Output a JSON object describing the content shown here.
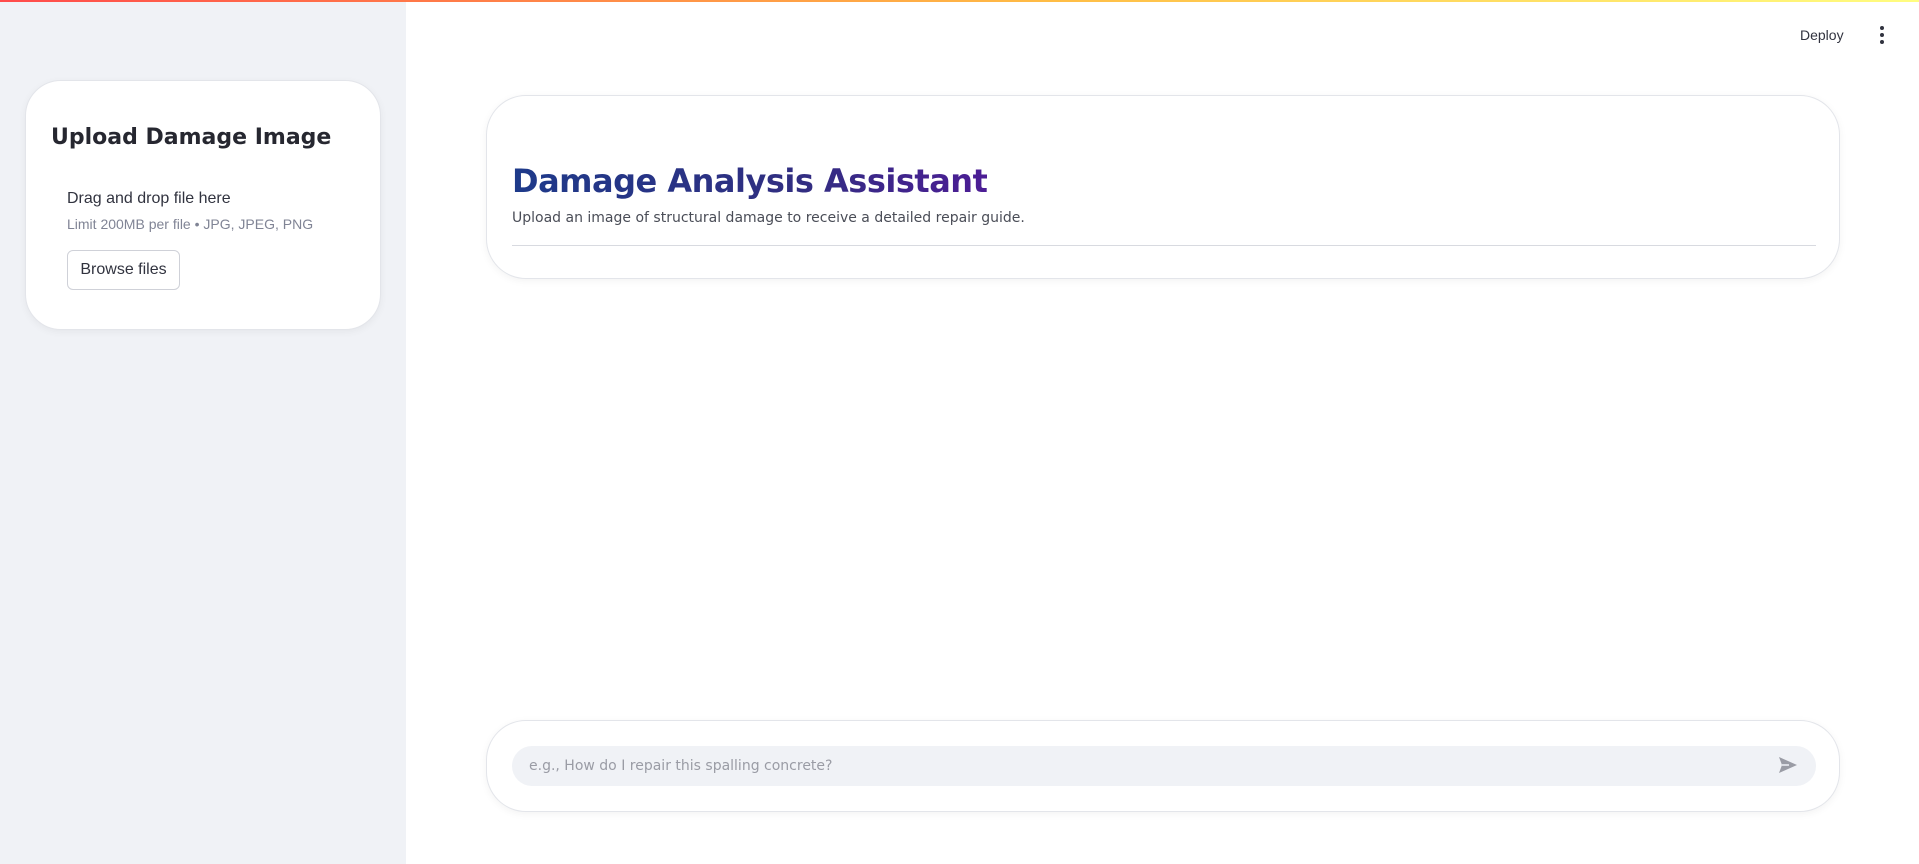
{
  "sidebar": {
    "uploader": {
      "title": "Upload Damage Image",
      "drop_text": "Drag and drop file here",
      "limit_text": "Limit 200MB per file • JPG, JPEG, PNG",
      "browse_label": "Browse files"
    }
  },
  "toolbar": {
    "deploy_label": "Deploy",
    "menu_icon": "vertical-ellipsis-icon"
  },
  "header": {
    "title": "Damage Analysis Assistant",
    "subtitle": "Upload an image of structural damage to receive a detailed repair guide."
  },
  "chat": {
    "placeholder": "e.g., How do I repair this spalling concrete?",
    "value": "",
    "send_icon": "send-icon"
  },
  "colors": {
    "sidebar_bg": "#f0f2f6",
    "title_gradient_start": "#1e3a8a",
    "title_gradient_end": "#4c1d95",
    "accent_stripe_start": "#ff4b4b",
    "accent_stripe_end": "#fffd80"
  }
}
